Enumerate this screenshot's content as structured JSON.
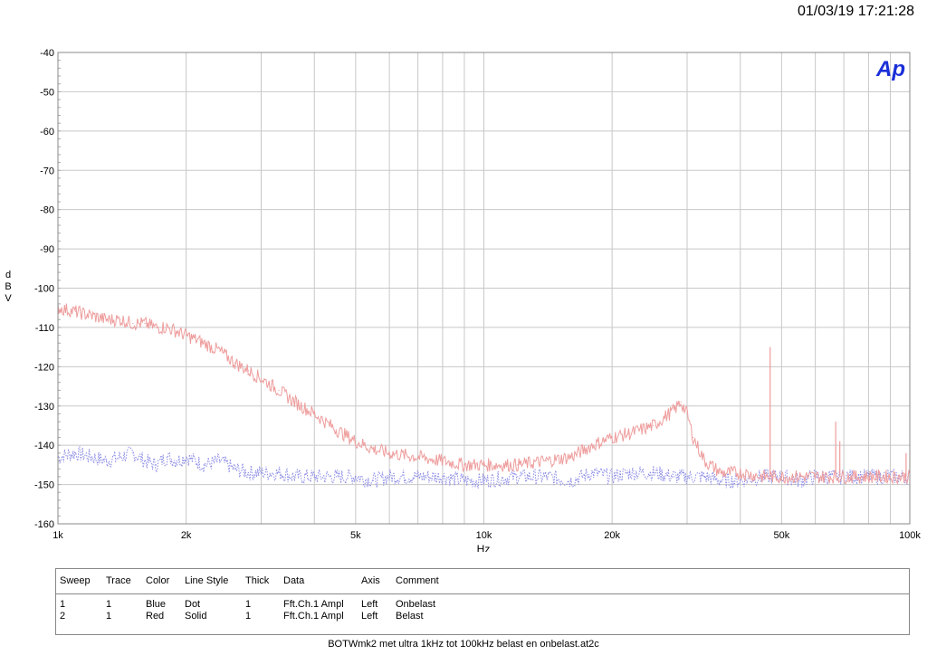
{
  "timestamp": "01/03/19 17:21:28",
  "logo_text": "Ap",
  "colors": {
    "grid": "#c8c8c8",
    "frame": "#888888",
    "blue": "#8a8ae6",
    "red": "#ee9d9d",
    "logo": "#1a2fd8"
  },
  "legend_table": {
    "headers": [
      "Sweep",
      "Trace",
      "Color",
      "Line Style",
      "Thick",
      "Data",
      "Axis",
      "Comment"
    ],
    "rows": [
      [
        "1",
        "1",
        "Blue",
        "Dot",
        "1",
        "Fft.Ch.1 Ampl",
        "Left",
        "Onbelast"
      ],
      [
        "2",
        "1",
        "Red",
        "Solid",
        "1",
        "Fft.Ch.1 Ampl",
        "Left",
        "Belast"
      ]
    ]
  },
  "caption": "BOTWmk2 met ultra 1kHz tot 100kHz belast en onbelast.at2c",
  "chart_data": {
    "type": "line",
    "x_scale": "log",
    "xlim": [
      1000,
      100000
    ],
    "ylim": [
      -160,
      -40
    ],
    "grid": true,
    "xlabel": "Hz",
    "ylabel": "dBV",
    "x_tick_labels": [
      {
        "value": 1000,
        "label": "1k"
      },
      {
        "value": 2000,
        "label": "2k"
      },
      {
        "value": 5000,
        "label": "5k"
      },
      {
        "value": 10000,
        "label": "10k"
      },
      {
        "value": 20000,
        "label": "20k"
      },
      {
        "value": 50000,
        "label": "50k"
      },
      {
        "value": 100000,
        "label": "100k"
      }
    ],
    "x_gridlines": [
      1000,
      2000,
      3000,
      4000,
      5000,
      6000,
      7000,
      8000,
      9000,
      10000,
      20000,
      30000,
      40000,
      50000,
      60000,
      70000,
      80000,
      90000,
      100000
    ],
    "y_ticks": [
      -40,
      -50,
      -60,
      -70,
      -80,
      -90,
      -100,
      -110,
      -120,
      -130,
      -140,
      -150,
      -160
    ],
    "series": [
      {
        "name": "Onbelast",
        "color": "#8a8ae6",
        "style": "dot",
        "x": [
          1000,
          1100,
          1200,
          1300,
          1400,
          1500,
          1600,
          1700,
          1800,
          1900,
          2000,
          2200,
          2400,
          2600,
          2800,
          3000,
          3300,
          3600,
          4000,
          4500,
          5000,
          5500,
          6000,
          7000,
          8000,
          9000,
          10000,
          12000,
          14000,
          16000,
          18000,
          20000,
          22000,
          25000,
          28000,
          30000,
          33000,
          36000,
          40000,
          45000,
          48000,
          50000,
          55000,
          60000,
          65000,
          70000,
          75000,
          80000,
          85000,
          90000,
          95000,
          100000
        ],
        "y": [
          -143,
          -142,
          -143,
          -144,
          -143,
          -142,
          -144,
          -145,
          -143,
          -144,
          -143,
          -145,
          -144,
          -146,
          -147,
          -147,
          -147,
          -148,
          -148,
          -148,
          -148,
          -149,
          -148,
          -148,
          -148,
          -149,
          -149,
          -148,
          -148,
          -149,
          -147,
          -148,
          -147,
          -147,
          -148,
          -148,
          -148,
          -149,
          -149,
          -148,
          -148,
          -148,
          -149,
          -148,
          -148,
          -148,
          -148,
          -148,
          -148,
          -148,
          -148,
          -148
        ]
      },
      {
        "name": "Belast",
        "color": "#ee9d9d",
        "style": "solid",
        "x": [
          1000,
          1100,
          1200,
          1300,
          1400,
          1500,
          1600,
          1700,
          1800,
          1900,
          2000,
          2200,
          2400,
          2600,
          2800,
          3000,
          3300,
          3600,
          4000,
          4500,
          5000,
          5500,
          6000,
          7000,
          8000,
          9000,
          10000,
          12000,
          14000,
          16000,
          18000,
          20000,
          22000,
          25000,
          28000,
          29000,
          30000,
          31000,
          33000,
          36000,
          40000,
          45000,
          48000,
          50000,
          55000,
          60000,
          65000,
          70000,
          75000,
          80000,
          85000,
          90000,
          95000,
          100000
        ],
        "y": [
          -105,
          -106,
          -107,
          -108,
          -108,
          -109,
          -109,
          -110,
          -110,
          -111,
          -112,
          -114,
          -116,
          -119,
          -121,
          -123,
          -126,
          -129,
          -132,
          -136,
          -139,
          -141,
          -142,
          -143,
          -144,
          -145,
          -145,
          -145,
          -144,
          -143,
          -140,
          -138,
          -137,
          -135,
          -131,
          -129,
          -132,
          -138,
          -144,
          -147,
          -147,
          -148,
          -148,
          -148,
          -148,
          -148,
          -148,
          -148,
          -148,
          -148,
          -148,
          -148,
          -148,
          -148
        ]
      }
    ],
    "peaks": [
      {
        "x": 47000,
        "y": -115
      },
      {
        "x": 67000,
        "y": -134
      },
      {
        "x": 68500,
        "y": -139
      },
      {
        "x": 98000,
        "y": -142
      }
    ]
  }
}
